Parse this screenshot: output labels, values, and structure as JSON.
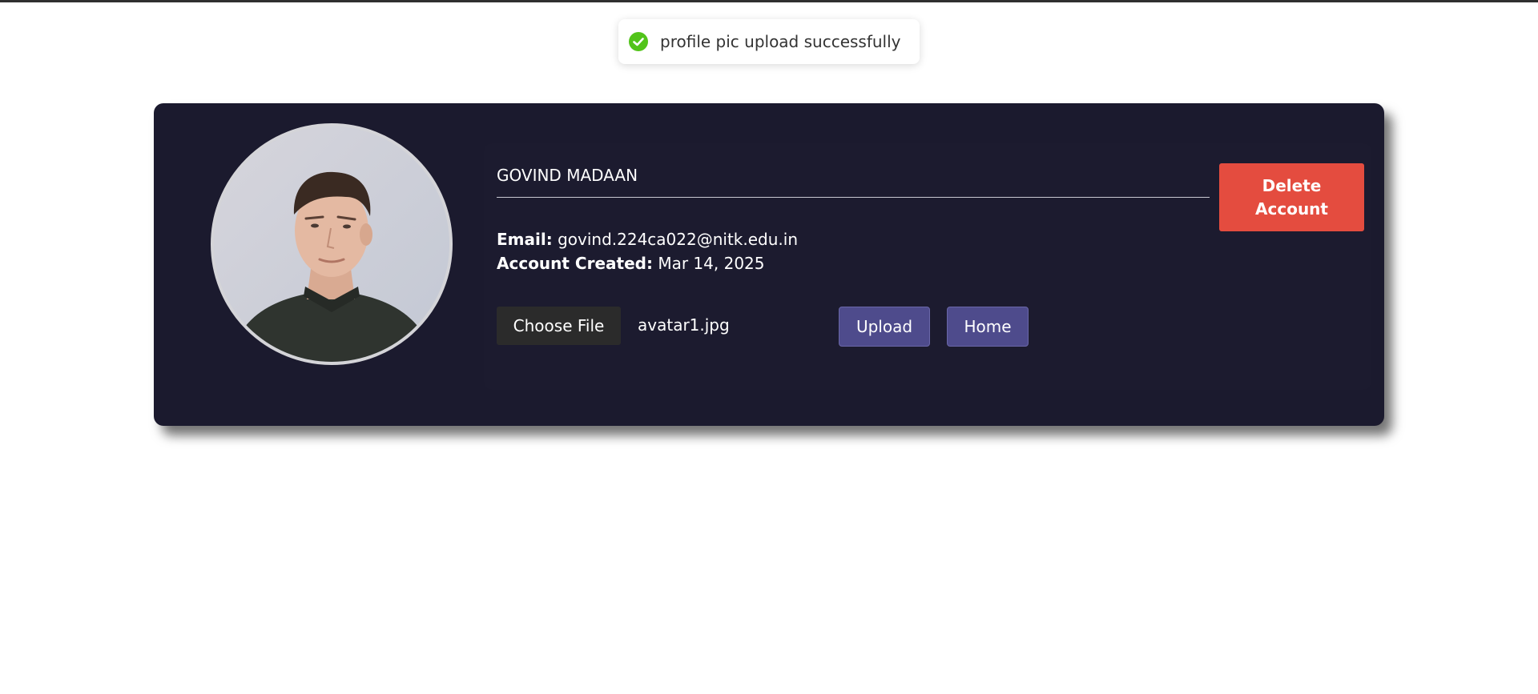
{
  "toast": {
    "icon": "check-circle-icon",
    "message": "profile pic upload successfully",
    "accent": "#52c41a"
  },
  "profile": {
    "avatar_alt": "profile photo",
    "name": "GOVIND MADAAN",
    "email_label": "Email:",
    "email": "govind.224ca022@nitk.edu.in",
    "created_label": "Account Created:",
    "created": "Mar 14, 2025"
  },
  "file_input": {
    "choose_label": "Choose File",
    "file_name": "avatar1.jpg"
  },
  "actions": {
    "upload_label": "Upload",
    "home_label": "Home",
    "delete_label": "Delete Account"
  },
  "colors": {
    "card_bg": "#1b1a2e",
    "primary_button": "#4e4b8c",
    "danger_button": "#e44c3f"
  }
}
